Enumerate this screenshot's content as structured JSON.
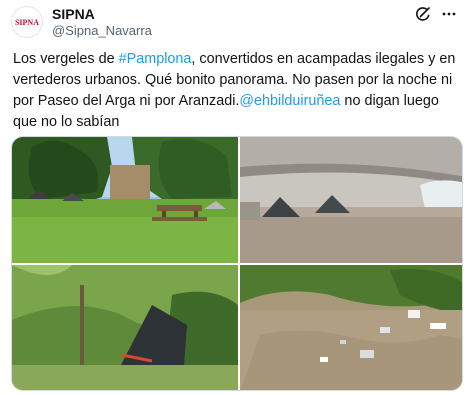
{
  "account": {
    "avatar_text": "SIPNA",
    "display_name": "SIPNA",
    "handle": "@Sipna_Navarra"
  },
  "tweet": {
    "text_1": "Los vergeles de ",
    "hashtag": "#Pamplona",
    "text_2": ", convertidos en acampadas ilegales y en vertederos urbanos. Qué bonito panorama. No pasen por la noche ni por Paseo del Arga ni por Aranzadi.",
    "mention": "@ehbilduiruñea",
    "text_3": " no digan luego que no lo sabían"
  },
  "icons": {
    "grok": "grok-icon",
    "more": "more-horizontal-icon"
  },
  "colors": {
    "link": "#1d9bf0",
    "text": "#0f1419",
    "muted": "#536471"
  }
}
